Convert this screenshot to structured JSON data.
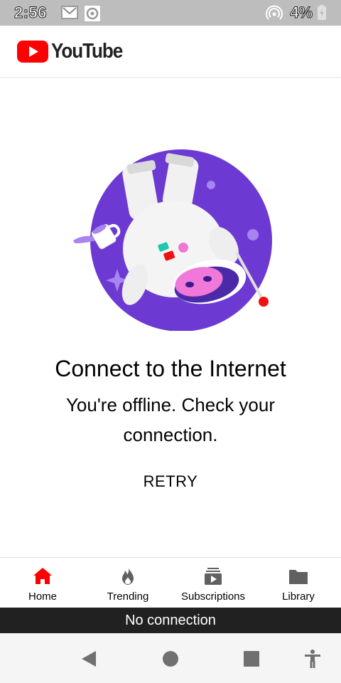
{
  "status_bar": {
    "time": "2:56",
    "battery_text": "4%",
    "icons": [
      "gmail-icon",
      "sync-icon",
      "hotspot-icon",
      "battery-charging-icon"
    ]
  },
  "app_bar": {
    "logo_text": "YouTube",
    "brand_color": "#ff0000"
  },
  "main": {
    "illustration": "offline-astronaut-cow-illustration",
    "title": "Connect to the Internet",
    "subtitle": "You're offline. Check your connection.",
    "retry_label": "RETRY"
  },
  "bottom_nav": {
    "items": [
      {
        "label": "Home",
        "icon": "home-icon",
        "active": true
      },
      {
        "label": "Trending",
        "icon": "trending-flame-icon",
        "active": false
      },
      {
        "label": "Subscriptions",
        "icon": "subscriptions-icon",
        "active": false
      },
      {
        "label": "Library",
        "icon": "library-folder-icon",
        "active": false
      }
    ],
    "active_color": "#ff0000",
    "inactive_color": "#606060"
  },
  "snackbar": {
    "text": "No connection"
  },
  "system_nav": {
    "buttons": [
      "back-icon",
      "home-circle-icon",
      "recents-icon",
      "accessibility-icon"
    ]
  }
}
